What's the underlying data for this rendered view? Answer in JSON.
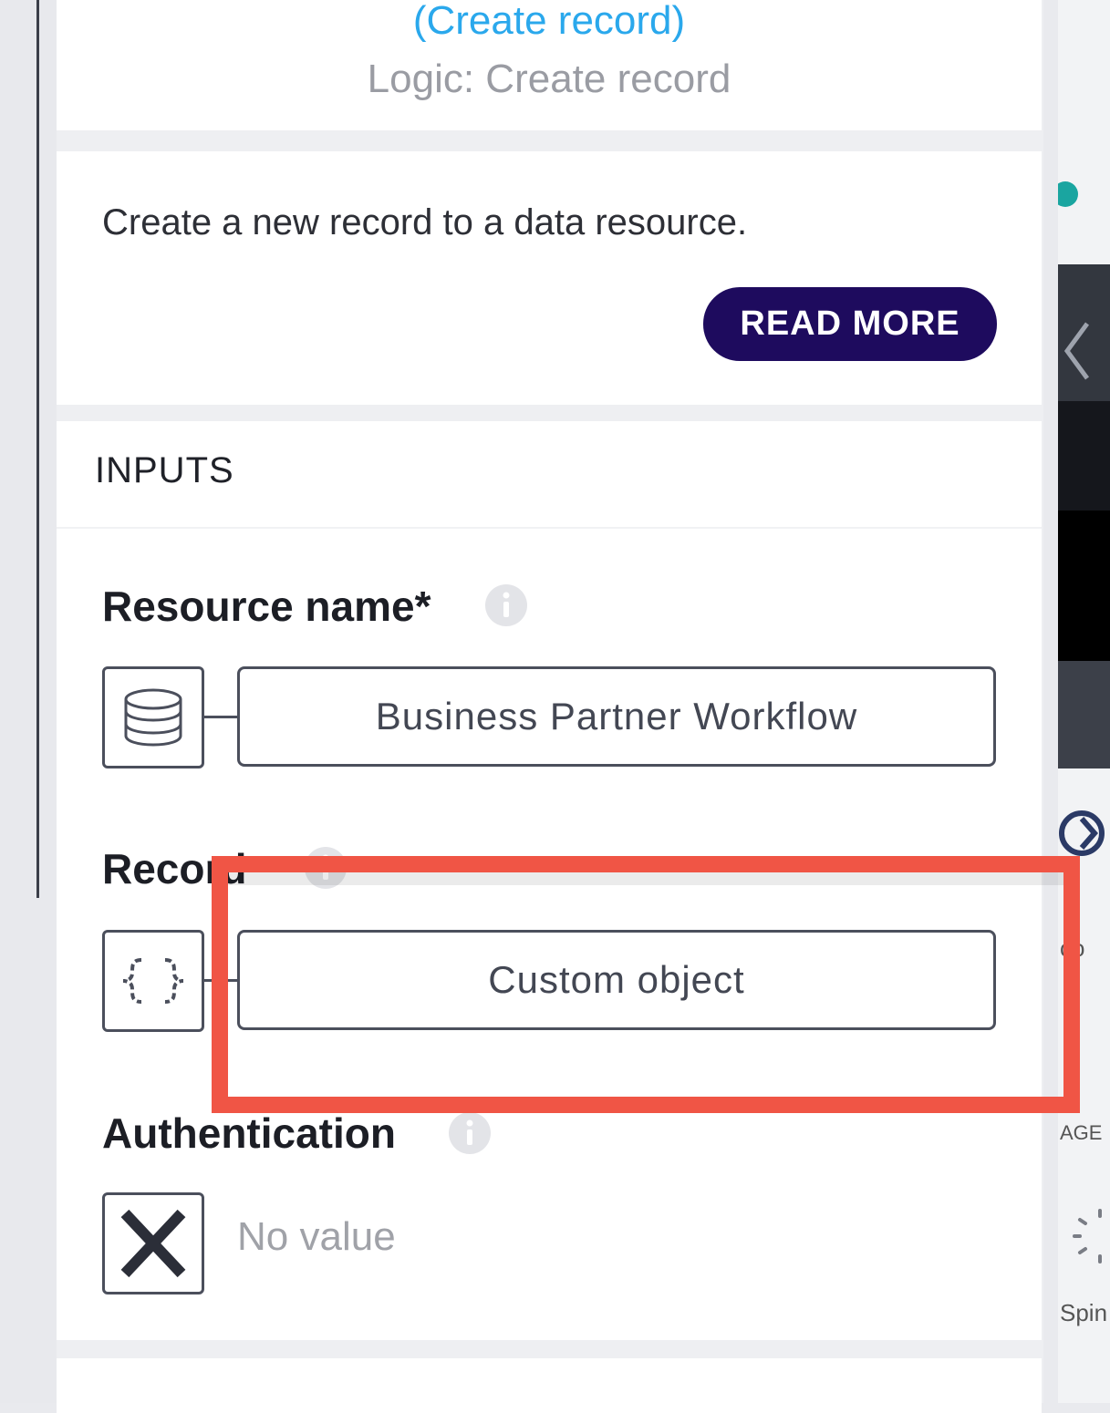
{
  "header": {
    "link_text": "(Create record)",
    "logic_text": "Logic: Create record"
  },
  "description": {
    "text": "Create a new record to a data resource.",
    "read_more_label": "READ MORE"
  },
  "inputs": {
    "title": "INPUTS",
    "resource_name": {
      "label": "Resource name*",
      "value": "Business Partner Workflow",
      "icon": "database-icon"
    },
    "record": {
      "label": "Record",
      "value": "Custom object",
      "icon": "braces-icon"
    },
    "authentication": {
      "label": "Authentication",
      "value": "No value",
      "icon": "x-icon"
    }
  },
  "right_panel": {
    "text_co": "co",
    "text_age": "AGE",
    "text_spin": "Spin"
  },
  "colors": {
    "accent_link": "#2aa8ec",
    "button_bg": "#1e0b5e",
    "highlight": "#f05545"
  }
}
